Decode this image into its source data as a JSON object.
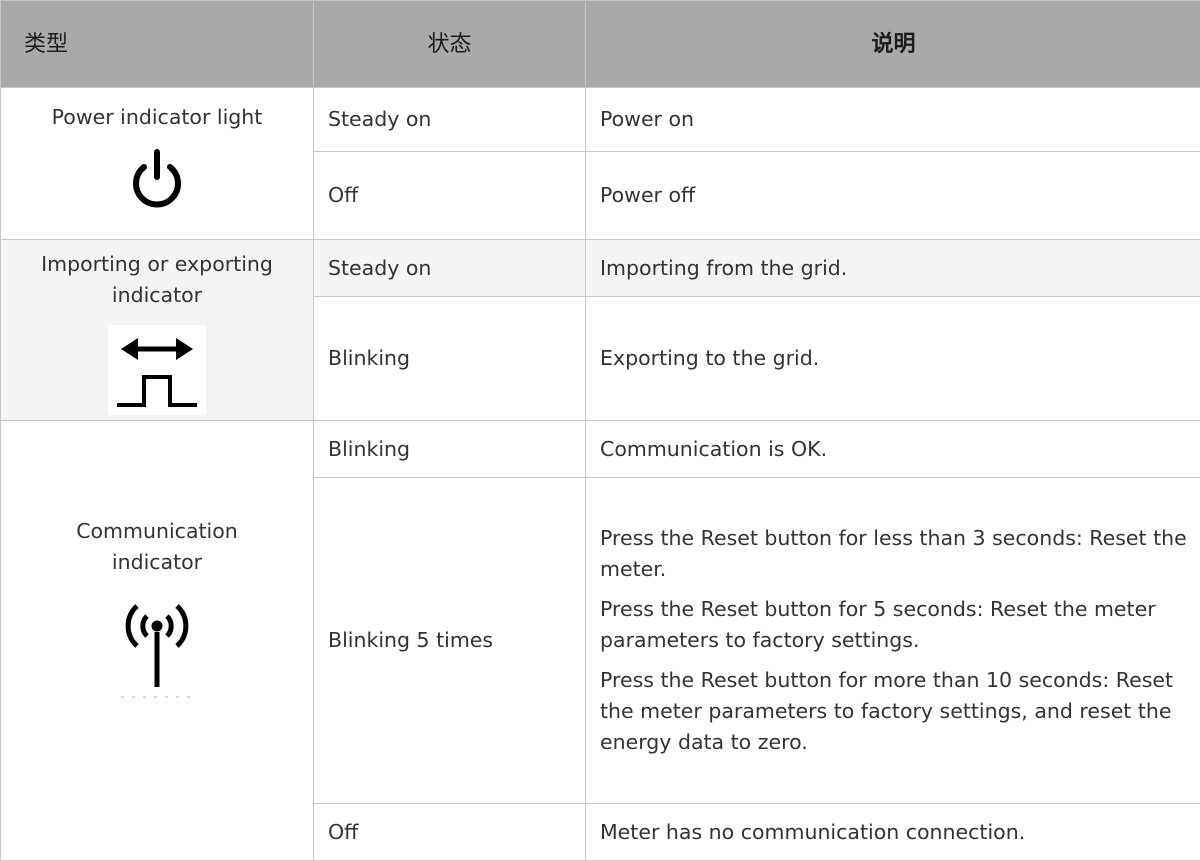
{
  "header": {
    "type": "类型",
    "state": "状态",
    "description": "说明"
  },
  "groups": [
    {
      "type_label": "Power indicator light",
      "icon": "power-icon",
      "rows": [
        {
          "state": "Steady on",
          "description": [
            "Power on"
          ]
        },
        {
          "state": "Off",
          "description": [
            "Power off"
          ]
        }
      ]
    },
    {
      "type_label": "Importing or exporting indicator",
      "icon": "import-export-icon",
      "rows": [
        {
          "state": "Steady on",
          "description": [
            "Importing from the grid."
          ]
        },
        {
          "state": "Blinking",
          "description": [
            "Exporting to the grid."
          ]
        }
      ]
    },
    {
      "type_label": "Communication indicator",
      "icon": "signal-antenna-icon",
      "rows": [
        {
          "state": "Blinking",
          "description": [
            "Communication is OK."
          ]
        },
        {
          "state": "Blinking 5 times",
          "description": [
            "Press the Reset button for less than 3 seconds: Reset the meter.",
            "Press the Reset button for 5 seconds: Reset the meter parameters to factory settings.",
            "Press the Reset button for more than 10 seconds: Reset the meter parameters to factory settings, and reset the energy data to zero."
          ]
        },
        {
          "state": "Off",
          "description": [
            "Meter has no communication connection."
          ]
        }
      ]
    }
  ]
}
